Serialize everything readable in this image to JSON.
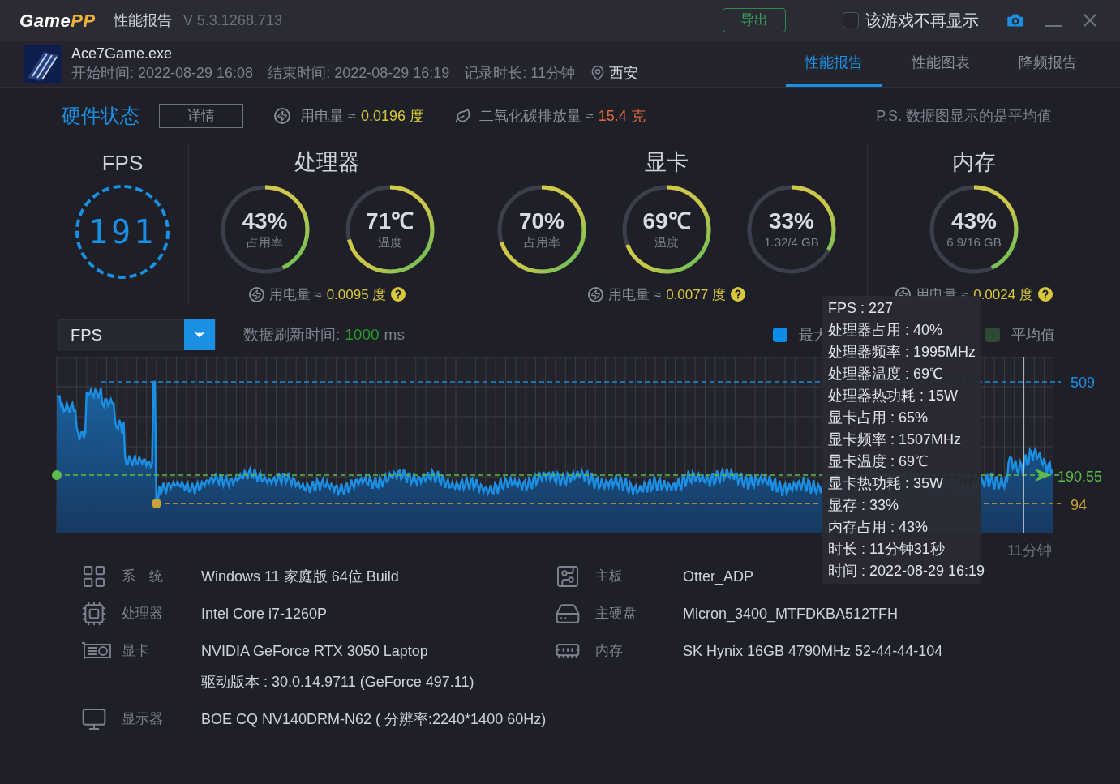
{
  "app": {
    "logo": [
      "Game",
      "PP"
    ],
    "title": "性能报告",
    "version": "V 5.3.1268.713",
    "export_button": "导出",
    "hide_checkbox": {
      "label": "该游戏不再显示",
      "checked": false
    }
  },
  "game": {
    "name": "Ace7Game.exe",
    "start": "开始时间: 2022-08-29 16:08",
    "end": "结束时间: 2022-08-29 16:19",
    "duration": "记录时长: 11分钟",
    "location": "西安"
  },
  "tabs": [
    {
      "label": "性能报告",
      "selected": true
    },
    {
      "label": "性能图表",
      "selected": false
    },
    {
      "label": "降频报告",
      "selected": false
    }
  ],
  "hardware": {
    "title": "硬件状态",
    "details_button": "详情",
    "power_label": "用电量 ≈",
    "power_value": "0.0196 度",
    "co2_label": "二氧化碳排放量 ≈",
    "co2_value": "15.4 克",
    "note": "P.S. 数据图显示的是平均值"
  },
  "fps": {
    "title": "FPS",
    "value": "191"
  },
  "groups": [
    {
      "title": "处理器",
      "power_label": "用电量 ≈",
      "power_value": "0.0095 度",
      "gauges": [
        {
          "value": "43%",
          "label": "占用率",
          "level": 0.43
        },
        {
          "value": "71℃",
          "label": "温度",
          "level": 0.71
        }
      ]
    },
    {
      "title": "显卡",
      "power_label": "用电量 ≈",
      "power_value": "0.0077 度",
      "gauges": [
        {
          "value": "70%",
          "label": "占用率",
          "level": 0.7
        },
        {
          "value": "69℃",
          "label": "温度",
          "level": 0.69
        },
        {
          "value": "33%",
          "label": "1.32/4 GB",
          "level": 0.33
        }
      ]
    },
    {
      "title": "内存",
      "power_label": "用电量 ≈",
      "power_value": "0.0024 度",
      "gauges": [
        {
          "value": "43%",
          "label": "6.9/16 GB",
          "level": 0.43
        }
      ]
    }
  ],
  "chart": {
    "metric": "FPS",
    "refresh_label": "数据刷新时间:",
    "refresh_value": "1000",
    "refresh_unit": "ms",
    "legend": [
      {
        "label": "最大",
        "color": "#0a8ee8"
      },
      {
        "label": "平均值",
        "color": "#2f4a33"
      }
    ],
    "max_label": "509",
    "avg_label": "190.55",
    "min_label": "94",
    "x_label": "11分钟",
    "tooltip": [
      "FPS : 227",
      "处理器占用 : 40%",
      "处理器频率 : 1995MHz",
      "处理器温度 : 69℃",
      "处理器热功耗 : 15W",
      "显卡占用 : 65%",
      "显卡频率 : 1507MHz",
      "显卡温度 : 69℃",
      "显卡热功耗 : 35W",
      "显存 : 33%",
      "内存占用 : 43%",
      "时长 : 11分钟31秒",
      "时间 : 2022-08-29 16:19"
    ]
  },
  "system_info": {
    "left": [
      {
        "kind": "system",
        "label": "系　统",
        "lines": [
          "Windows 11 家庭版 64位   Build"
        ]
      },
      {
        "kind": "cpu",
        "label": "处理器",
        "lines": [
          "Intel Core i7-1260P"
        ]
      },
      {
        "kind": "gpu",
        "label": "显卡",
        "lines": [
          "NVIDIA GeForce RTX 3050 Laptop",
          "驱动版本 : 30.0.14.9711 (GeForce 497.11)"
        ]
      },
      {
        "kind": "monitor",
        "label": "显示器",
        "lines": [
          "BOE CQ NV140DRM-N62 ( 分辨率:2240*1400 60Hz)"
        ]
      }
    ],
    "right": [
      {
        "kind": "board",
        "label": "主板",
        "lines": [
          "Otter_ADP"
        ]
      },
      {
        "kind": "disk",
        "label": "主硬盘",
        "lines": [
          "Micron_3400_MTFDKBA512TFH"
        ]
      },
      {
        "kind": "memory",
        "label": "内存",
        "lines": [
          "SK Hynix 16GB 4790MHz 52-44-44-104"
        ]
      }
    ]
  }
}
